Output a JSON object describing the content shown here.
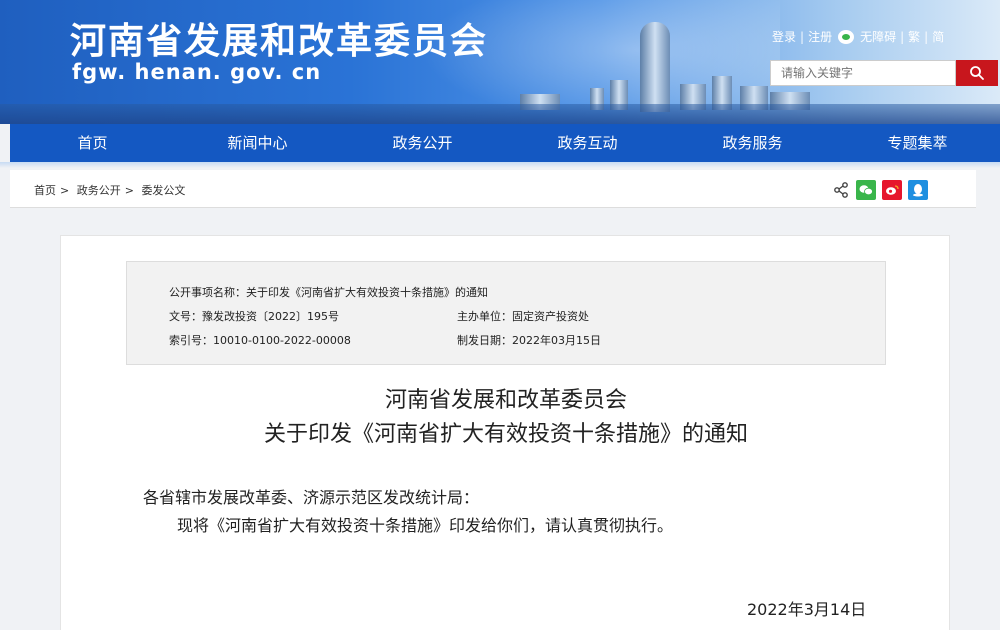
{
  "header": {
    "site_title": "河南省发展和改革委员会",
    "site_domain": "fgw. henan. gov. cn",
    "top_links": {
      "login": "登录",
      "register": "注册",
      "accessibility": "无障碍",
      "traditional": "繁",
      "simplified": "简",
      "separator": "|"
    },
    "search": {
      "placeholder": "请输入关键字"
    }
  },
  "nav": {
    "items": [
      {
        "label": "首页"
      },
      {
        "label": "新闻中心"
      },
      {
        "label": "政务公开"
      },
      {
        "label": "政务互动"
      },
      {
        "label": "政务服务"
      },
      {
        "label": "专题集萃"
      }
    ]
  },
  "breadcrumb": {
    "items": [
      "首页",
      "政务公开",
      "委发公文"
    ],
    "separator": ">"
  },
  "meta": {
    "item_name_label": "公开事项名称：",
    "item_name_value": "关于印发《河南省扩大有效投资十条措施》的通知",
    "doc_no_label": "文号：",
    "doc_no_value": "豫发改投资〔2022〕195号",
    "dept_label": "主办单位：",
    "dept_value": "固定资产投资处",
    "index_label": "索引号：",
    "index_value": "10010-0100-2022-00008",
    "date_label": "制发日期：",
    "date_value": "2022年03月15日"
  },
  "article": {
    "title_line1": "河南省发展和改革委员会",
    "title_line2": "关于印发《河南省扩大有效投资十条措施》的通知",
    "salutation": "各省辖市发展改革委、济源示范区发改统计局：",
    "body": "现将《河南省扩大有效投资十条措施》印发给你们，请认真贯彻执行。",
    "date": "2022年3月14日"
  },
  "colors": {
    "nav_blue": "#1458c2",
    "search_red": "#c8161d",
    "wechat_green": "#39b54a",
    "weibo_red": "#e6162d",
    "qq_blue": "#1e8fe0"
  }
}
